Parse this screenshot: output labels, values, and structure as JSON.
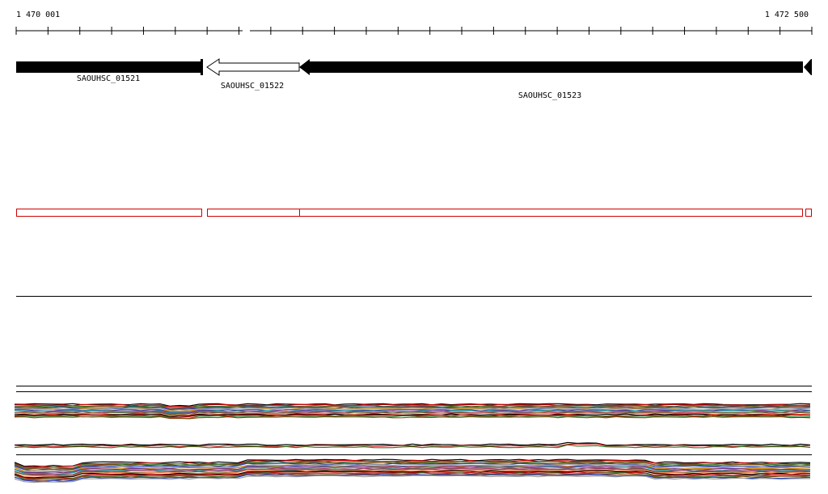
{
  "ruler": {
    "start_label": "1 470 001",
    "end_label": "1 472 500",
    "start": 1470001,
    "end": 1472500
  },
  "genes": [
    {
      "label": "SAOUHSC_01521",
      "strand": "+",
      "style": "filled"
    },
    {
      "label": "SAOUHSC_01522",
      "strand": "-",
      "style": "outline"
    },
    {
      "label": "SAOUHSC_01523",
      "strand": "-",
      "style": "filled"
    }
  ],
  "colors": {
    "gene_fill": "#000000",
    "exon_box": "#cc0000",
    "track_line": "#000000"
  }
}
